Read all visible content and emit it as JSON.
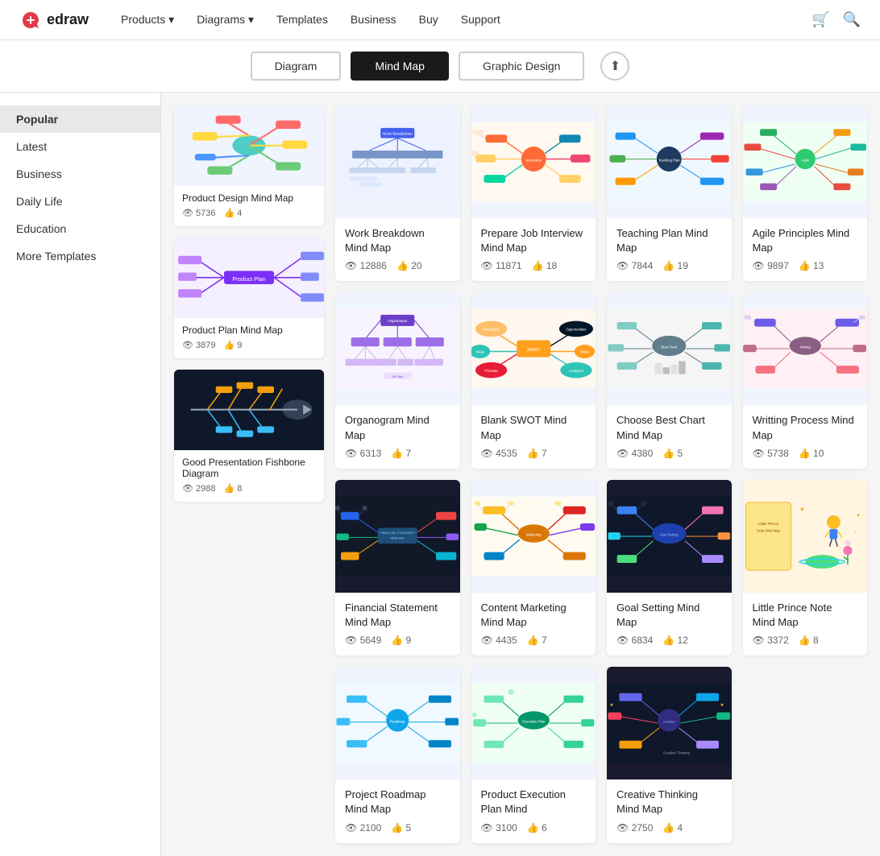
{
  "nav": {
    "logo": "edraw",
    "links": [
      "Products",
      "Diagrams",
      "Templates",
      "Business",
      "Buy",
      "Support"
    ]
  },
  "toolbar": {
    "tabs": [
      "Diagram",
      "Mind Map",
      "Graphic Design"
    ],
    "active_tab": "Mind Map"
  },
  "sidebar": {
    "items": [
      "Popular",
      "Latest",
      "Business",
      "Daily Life",
      "Education",
      "More Templates"
    ],
    "active": "Popular"
  },
  "sidebar_cards": [
    {
      "title": "Product Design Mind Map",
      "views": "5736",
      "likes": "4",
      "bg": "light",
      "color_scheme": "colorful"
    },
    {
      "title": "Product Plan Mind Map",
      "views": "3879",
      "likes": "9",
      "bg": "light",
      "color_scheme": "blue"
    },
    {
      "title": "Good Presentation Fishbone Diagram",
      "views": "2988",
      "likes": "8",
      "bg": "dark",
      "color_scheme": "dark"
    }
  ],
  "cards": [
    {
      "title": "Work Breakdown Mind Map",
      "views": "12886",
      "likes": "20",
      "bg": "light",
      "row": 1
    },
    {
      "title": "Prepare Job Interview Mind Map",
      "views": "11871",
      "likes": "18",
      "bg": "light",
      "row": 1
    },
    {
      "title": "Teaching Plan Mind Map",
      "views": "7844",
      "likes": "19",
      "bg": "light",
      "row": 1
    },
    {
      "title": "Agile Principles Mind Map",
      "views": "9897",
      "likes": "13",
      "bg": "light",
      "row": 1
    },
    {
      "title": "Organogram Mind Map",
      "views": "6313",
      "likes": "7",
      "bg": "light",
      "row": 2
    },
    {
      "title": "Blank SWOT Mind Map",
      "views": "4535",
      "likes": "7",
      "bg": "light",
      "row": 2
    },
    {
      "title": "Choose Best Chart Mind Map",
      "views": "4380",
      "likes": "5",
      "bg": "light",
      "row": 2
    },
    {
      "title": "Writting Process Mind Map",
      "views": "5738",
      "likes": "10",
      "bg": "light",
      "row": 2
    },
    {
      "title": "Financial Statement Mind Map",
      "views": "5649",
      "likes": "9",
      "bg": "dark",
      "row": 3
    },
    {
      "title": "Content Marketing Mind Map",
      "views": "4435",
      "likes": "7",
      "bg": "light",
      "row": 3
    },
    {
      "title": "Goal Setting Mind Map",
      "views": "6834",
      "likes": "12",
      "bg": "dark",
      "row": 3
    },
    {
      "title": "Little Prince Note Mind Map",
      "views": "3372",
      "likes": "8",
      "bg": "light",
      "row": 3
    },
    {
      "title": "Project Roadmap Mind Map",
      "views": "2100",
      "likes": "5",
      "bg": "light",
      "row": 4
    },
    {
      "title": "Product Execution Plan Mind",
      "views": "3100",
      "likes": "6",
      "bg": "light",
      "row": 4
    },
    {
      "title": "Creative Thinking Mind Map",
      "views": "2750",
      "likes": "4",
      "bg": "dark",
      "row": 4
    }
  ]
}
